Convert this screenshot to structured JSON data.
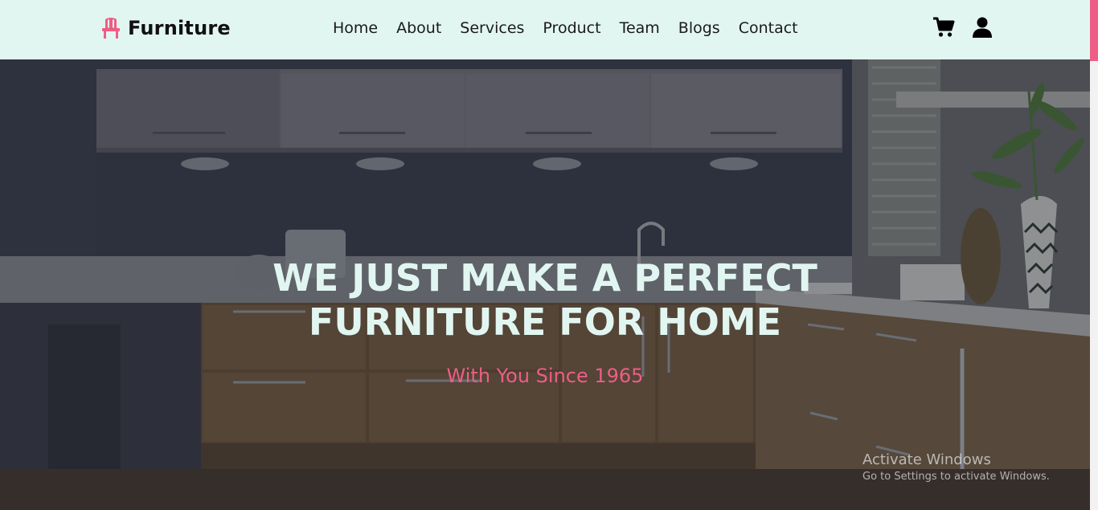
{
  "brand": {
    "name": "Furniture",
    "icon": "chair-icon",
    "accent_color": "#ee5d85"
  },
  "nav": {
    "links": [
      "Home",
      "About",
      "Services",
      "Product",
      "Team",
      "Blogs",
      "Contact"
    ],
    "cart_icon": "cart-icon",
    "user_icon": "user-icon",
    "background_color": "#e2f6f1"
  },
  "hero": {
    "title_line1": "WE JUST MAKE A PERFECT",
    "title_line2": "FURNITURE FOR HOME",
    "subtitle": "With You Since 1965",
    "title_color": "#e2f6f1",
    "subtitle_color": "#ee5d85"
  },
  "watermark": {
    "title": "Activate Windows",
    "subtitle": "Go to Settings to activate Windows."
  }
}
